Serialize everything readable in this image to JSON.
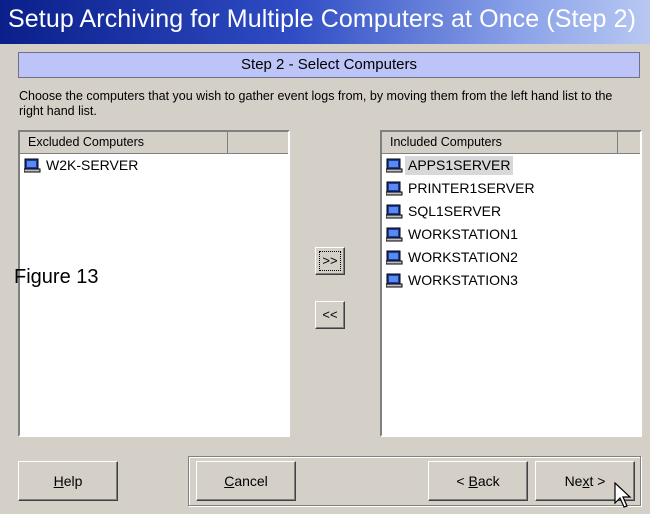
{
  "window": {
    "title": "Setup Archiving for Multiple Computers at Once (Step 2)"
  },
  "step": {
    "label": "Step 2 - Select Computers"
  },
  "description": "Choose the computers that you wish to gather event logs from, by moving them from the left hand list to the right hand list.",
  "excluded": {
    "header": "Excluded Computers",
    "items": [
      "W2K-SERVER"
    ]
  },
  "included": {
    "header": "Included Computers",
    "items": [
      "APPS1SERVER",
      "PRINTER1SERVER",
      "SQL1SERVER",
      "WORKSTATION1",
      "WORKSTATION2",
      "WORKSTATION3"
    ],
    "selected_index": 0
  },
  "move_buttons": {
    "add_all": ">>",
    "remove_all": "<<"
  },
  "figure_caption": "Figure 13",
  "buttons": {
    "help": {
      "pre": "",
      "hot": "H",
      "post": "elp"
    },
    "cancel": {
      "pre": "",
      "hot": "C",
      "post": "ancel"
    },
    "back": {
      "pre": "< ",
      "hot": "B",
      "post": "ack"
    },
    "next": {
      "pre": "Ne",
      "hot": "x",
      "post": "t >"
    }
  },
  "icons": {
    "computer": "computer-icon",
    "cursor": "mouse-pointer-icon"
  },
  "colors": {
    "title_start": "#0a1f8a",
    "title_end": "#b8c8f2",
    "step_bar": "#bcc4f8",
    "dialog_bg": "#d4d0c8"
  }
}
